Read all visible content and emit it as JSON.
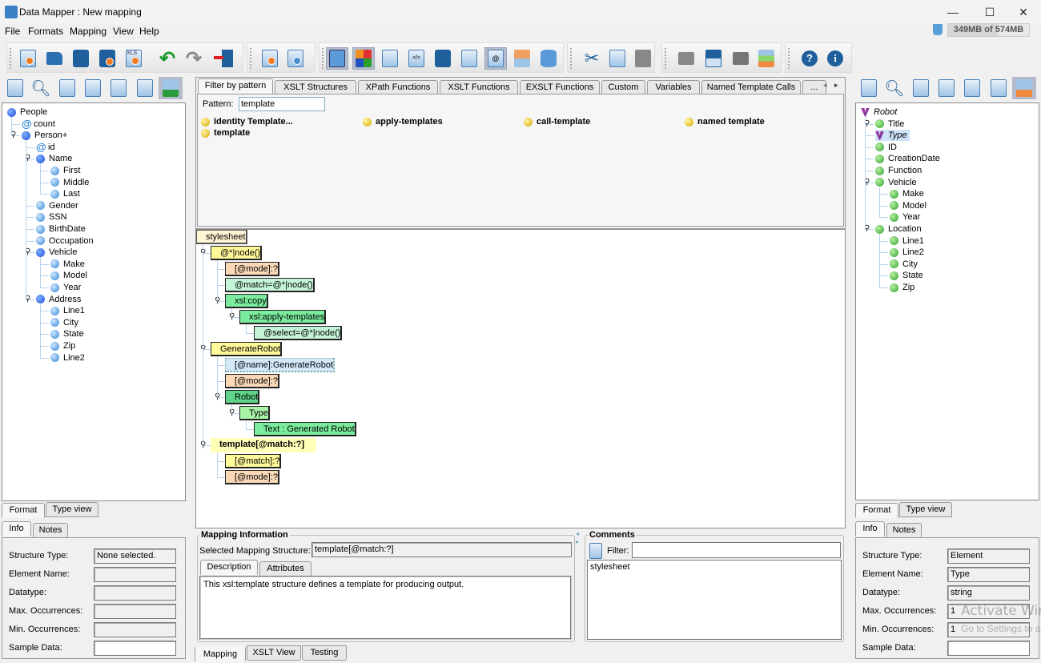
{
  "window": {
    "title": "Data Mapper : New mapping",
    "controls": [
      "—",
      "☐",
      "✕"
    ]
  },
  "menu": [
    "File",
    "Formats",
    "Mapping",
    "View",
    "Help"
  ],
  "memory": {
    "label": "349MB of 574MB",
    "used_fraction": 0.61
  },
  "toolbar": {
    "groups": [
      [
        "new-mapping-icon",
        "open-icon",
        "save-icon",
        "save-as-icon",
        "new-xls-icon",
        "undo-icon",
        "redo-icon",
        "exit-icon"
      ],
      [
        "new-structure-icon",
        "structure-settings-icon"
      ],
      [
        "show-info-icon",
        "show-colors-icon",
        "checklist-icon",
        "xml-source-icon",
        "save-schedule-icon",
        "document-icon",
        "at-icon",
        "layout-icon",
        "database-icon"
      ],
      [
        "cut-icon",
        "copy-icon",
        "paste-icon"
      ],
      [
        "move-icon",
        "insert-icon",
        "merge-icon",
        "layers-icon"
      ],
      [
        "help-icon",
        "about-icon"
      ]
    ]
  },
  "left_tree": [
    {
      "label": "People",
      "type": "blue",
      "lvl": 0
    },
    {
      "label": "count",
      "type": "at",
      "lvl": 1
    },
    {
      "label": "Person+",
      "type": "blue",
      "lvl": 1,
      "exp": true
    },
    {
      "label": "id",
      "type": "at",
      "lvl": 2
    },
    {
      "label": "Name",
      "type": "blue",
      "lvl": 2,
      "exp": true
    },
    {
      "label": "First",
      "type": "lblue",
      "lvl": 3
    },
    {
      "label": "Middle",
      "type": "lblue",
      "lvl": 3
    },
    {
      "label": "Last",
      "type": "lblue",
      "lvl": 3
    },
    {
      "label": "Gender",
      "type": "lblue",
      "lvl": 2
    },
    {
      "label": "SSN",
      "type": "lblue",
      "lvl": 2
    },
    {
      "label": "BirthDate",
      "type": "lblue",
      "lvl": 2
    },
    {
      "label": "Occupation",
      "type": "lblue",
      "lvl": 2
    },
    {
      "label": "Vehicle",
      "type": "blue",
      "lvl": 2,
      "exp": true
    },
    {
      "label": "Make",
      "type": "lblue",
      "lvl": 3
    },
    {
      "label": "Model",
      "type": "lblue",
      "lvl": 3
    },
    {
      "label": "Year",
      "type": "lblue",
      "lvl": 3
    },
    {
      "label": "Address",
      "type": "blue",
      "lvl": 2,
      "exp": true
    },
    {
      "label": "Line1",
      "type": "lblue",
      "lvl": 3
    },
    {
      "label": "City",
      "type": "lblue",
      "lvl": 3
    },
    {
      "label": "State",
      "type": "lblue",
      "lvl": 3
    },
    {
      "label": "Zip",
      "type": "lblue",
      "lvl": 3
    },
    {
      "label": "Line2",
      "type": "lblue",
      "lvl": 3
    }
  ],
  "right_tree": [
    {
      "label": "Robot",
      "type": "v",
      "lvl": 0,
      "italic": true
    },
    {
      "label": "Title",
      "type": "green",
      "lvl": 1,
      "exp": true
    },
    {
      "label": "Type",
      "type": "v",
      "lvl": 1,
      "italic": true,
      "selected": true
    },
    {
      "label": "ID",
      "type": "green",
      "lvl": 1
    },
    {
      "label": "CreationDate",
      "type": "green",
      "lvl": 1
    },
    {
      "label": "Function",
      "type": "green",
      "lvl": 1
    },
    {
      "label": "Vehicle",
      "type": "green",
      "lvl": 1,
      "exp": true
    },
    {
      "label": "Make",
      "type": "green",
      "lvl": 2
    },
    {
      "label": "Model",
      "type": "green",
      "lvl": 2
    },
    {
      "label": "Year",
      "type": "green",
      "lvl": 2
    },
    {
      "label": "Location",
      "type": "green",
      "lvl": 1,
      "exp": true
    },
    {
      "label": "Line1",
      "type": "green",
      "lvl": 2
    },
    {
      "label": "Line2",
      "type": "green",
      "lvl": 2
    },
    {
      "label": "City",
      "type": "green",
      "lvl": 2
    },
    {
      "label": "State",
      "type": "green",
      "lvl": 2
    },
    {
      "label": "Zip",
      "type": "green",
      "lvl": 2
    }
  ],
  "side_tabs": {
    "format": "Format",
    "type_view": "Type view",
    "info": "Info",
    "notes": "Notes"
  },
  "left_info": {
    "labels": [
      "Structure Type:",
      "Element Name:",
      "Datatype:",
      "Max. Occurrences:",
      "Min. Occurrences:",
      "Sample Data:"
    ],
    "values": [
      "None selected.",
      "",
      "",
      "",
      "",
      ""
    ]
  },
  "right_info": {
    "labels": [
      "Structure Type:",
      "Element Name:",
      "Datatype:",
      "Max. Occurrences:",
      "Min. Occurrences:",
      "Sample Data:"
    ],
    "values": [
      "Element",
      "Type",
      "string",
      "1",
      "1",
      ""
    ]
  },
  "palette": {
    "tabs": [
      "Filter by pattern",
      "XSLT Structures",
      "XPath Functions",
      "XSLT Functions",
      "EXSLT Functions",
      "Custom",
      "Variables",
      "Named Template Calls",
      "..."
    ],
    "pattern_label": "Pattern:",
    "pattern_value": "template",
    "results": [
      "Identity Template...",
      "apply-templates",
      "call-template",
      "named template",
      "template"
    ]
  },
  "mapping_tree": [
    {
      "label": "stylesheet",
      "style": "cream",
      "lvl": 0
    },
    {
      "label": "@*|node()",
      "style": "yellow",
      "lvl": 1,
      "exp": true
    },
    {
      "label": "[@mode]:?",
      "style": "orange",
      "lvl": 2
    },
    {
      "label": "@match=@*|node()",
      "style": "mint",
      "lvl": 2
    },
    {
      "label": "xsl:copy",
      "style": "green",
      "lvl": 2,
      "exp": true
    },
    {
      "label": "xsl:apply-templates",
      "style": "green",
      "lvl": 3,
      "exp": true
    },
    {
      "label": "@select=@*|node()",
      "style": "mint",
      "lvl": 4
    },
    {
      "label": "GenerateRobot",
      "style": "yellow",
      "lvl": 1,
      "exp": true
    },
    {
      "label": "[@name]:GenerateRobot",
      "style": "blue",
      "lvl": 2
    },
    {
      "label": "[@mode]:?",
      "style": "orange",
      "lvl": 2
    },
    {
      "label": "Robot",
      "style": "dgreen",
      "lvl": 2,
      "exp": true
    },
    {
      "label": "Type",
      "style": "lgreen",
      "lvl": 3,
      "exp": true
    },
    {
      "label": "Text : Generated Robot",
      "style": "green",
      "lvl": 4
    },
    {
      "label": "template[@match:?]",
      "style": "pale",
      "lvl": 1,
      "exp": true
    },
    {
      "label": "[@match]:?",
      "style": "yellow",
      "lvl": 2
    },
    {
      "label": "[@mode]:?",
      "style": "orange",
      "lvl": 2
    }
  ],
  "mapping_info": {
    "title": "Mapping Information",
    "selected_label": "Selected Mapping Structure:",
    "selected_value": "template[@match:?]",
    "tabs": [
      "Description",
      "Attributes"
    ],
    "description": "This xsl:template structure defines a template for producing output."
  },
  "comments": {
    "title": "Comments",
    "filter_label": "Filter:",
    "filter_value": "",
    "items": [
      "stylesheet"
    ]
  },
  "bottom_tabs": [
    "Mapping",
    "XSLT View",
    "Testing"
  ],
  "watermark": {
    "line1": "Activate Windows",
    "line2": "Go to Settings to activate Windows."
  }
}
